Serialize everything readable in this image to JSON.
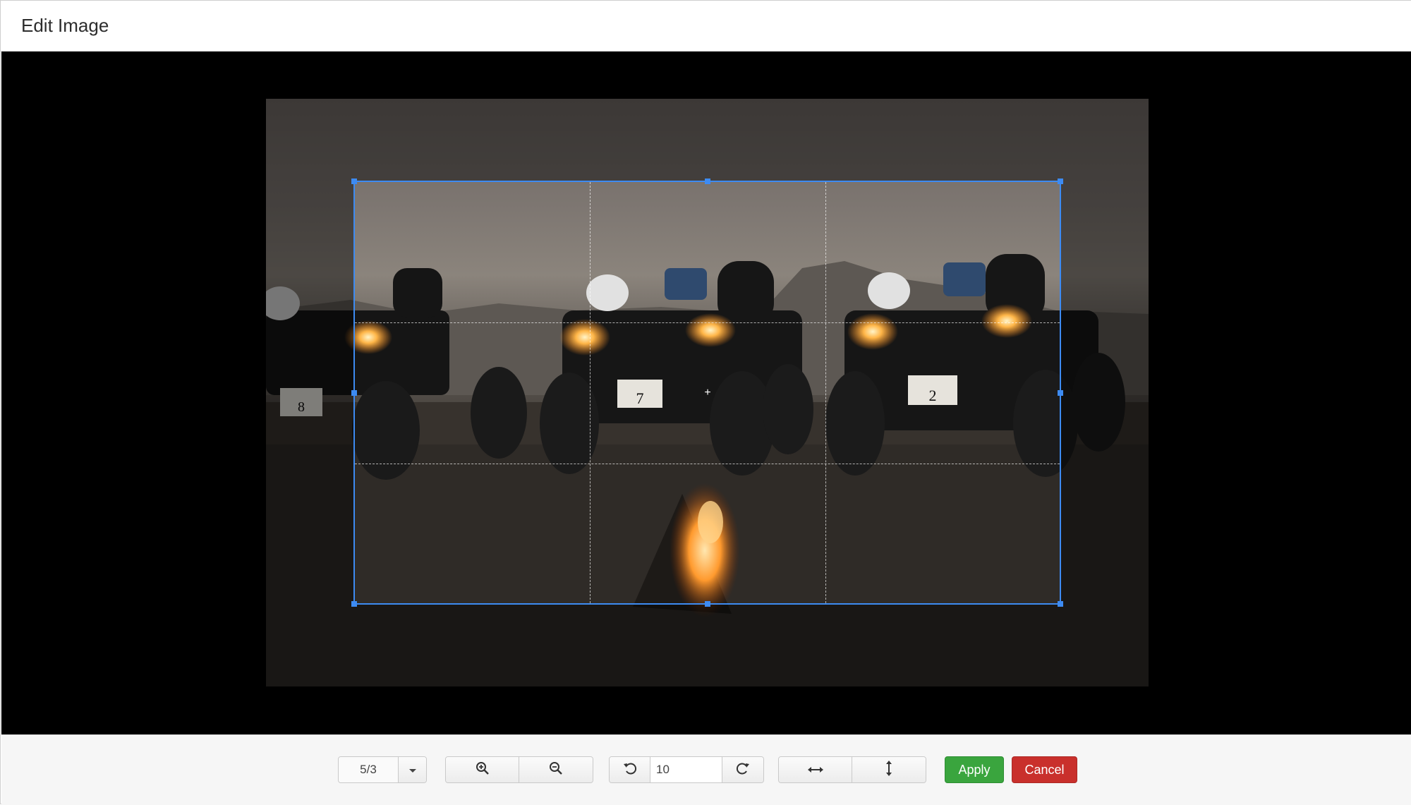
{
  "dialog": {
    "title": "Edit Image"
  },
  "image": {
    "description_icon": "photo-canvas",
    "plate_numbers": [
      "8",
      "7",
      "2"
    ]
  },
  "toolbar": {
    "aspect_ratio": "5/3",
    "aspect_dropdown_icon": "caret-down-icon",
    "zoom_in_icon": "zoom-in-icon",
    "zoom_out_icon": "zoom-out-icon",
    "rotate_left_icon": "rotate-left-icon",
    "rotate_angle": "10",
    "rotate_right_icon": "rotate-right-icon",
    "flip_horizontal_icon": "flip-horizontal-icon",
    "flip_vertical_icon": "flip-vertical-icon",
    "apply_label": "Apply",
    "cancel_label": "Cancel"
  },
  "colors": {
    "crop_border": "#3d8bf2",
    "apply": "#3aa53e",
    "cancel": "#c9302c",
    "stage": "#000000"
  }
}
